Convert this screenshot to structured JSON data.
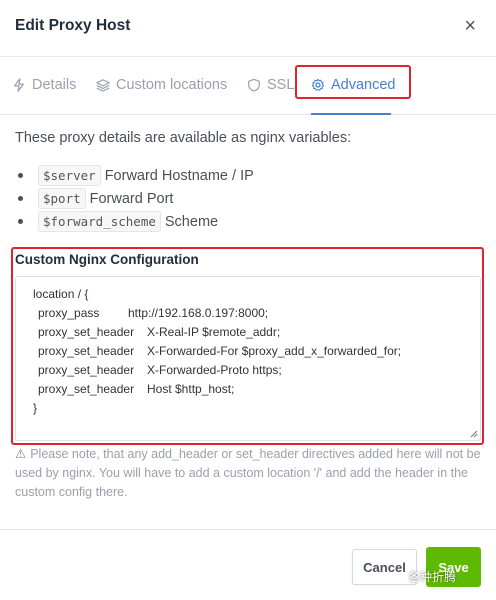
{
  "modal": {
    "title": "Edit Proxy Host",
    "close_glyph": "×"
  },
  "tabs": [
    {
      "label": "Details",
      "icon": "bolt-icon",
      "active": false
    },
    {
      "label": "Custom locations",
      "icon": "layers-icon",
      "active": false
    },
    {
      "label": "SSL",
      "icon": "shield-icon",
      "active": false
    },
    {
      "label": "Advanced",
      "icon": "gear-icon",
      "active": true
    }
  ],
  "advanced": {
    "intro": "These proxy details are available as nginx variables:",
    "variables": [
      {
        "code": "$server",
        "desc": "Forward Hostname / IP"
      },
      {
        "code": "$port",
        "desc": "Forward Port"
      },
      {
        "code": "$forward_scheme",
        "desc": "Scheme"
      }
    ],
    "config_label": "Custom Nginx Configuration",
    "config_lines": [
      "location / {",
      "proxy_pass",
      "http://192.168.0.197:8000;",
      "proxy_set_header",
      "X-Real-IP $remote_addr;",
      "proxy_set_header",
      "X-Forwarded-For $proxy_add_x_forwarded_for;",
      "proxy_set_header",
      "X-Forwarded-Proto https;",
      "proxy_set_header",
      "Host $http_host;",
      "}"
    ],
    "note_icon": "⚠",
    "note": "Please note, that any add_header or set_header directives added here will not be used by nginx. You will have to add a custom location '/' and add the header in the custom config there."
  },
  "footer": {
    "cancel_label": "Cancel",
    "save_label": "Save",
    "watermark": "各种折腾"
  },
  "colors": {
    "accent": "#467fcf",
    "highlight_border": "#e0242d",
    "save": "#5eba00"
  }
}
